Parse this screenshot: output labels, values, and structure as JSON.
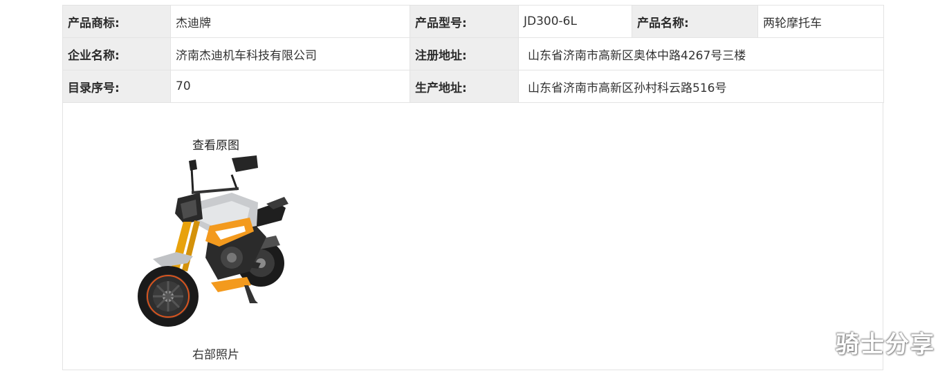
{
  "info": {
    "row1": {
      "brand_label": "产品商标:",
      "brand_value": "杰迪牌",
      "model_label": "产品型号:",
      "model_value": "JD300-6L",
      "name_label": "产品名称:",
      "name_value": "两轮摩托车"
    },
    "row2": {
      "company_label": "企业名称:",
      "company_value": "济南杰迪机车科技有限公司",
      "reg_addr_label": "注册地址:",
      "reg_addr_value": "山东省济南市高新区奥体中路4267号三楼"
    },
    "row3": {
      "catalog_label": "目录序号:",
      "catalog_value": "70",
      "prod_addr_label": "生产地址:",
      "prod_addr_value": "山东省济南市高新区孙村科云路516号"
    }
  },
  "photo": {
    "view_original": "查看原图",
    "caption": "右部照片",
    "image_icon": "motorcycle-illustration"
  },
  "watermark": "骑士分享",
  "colors": {
    "label_bg": "#eeeeee",
    "border": "#e3e3e3",
    "accent_orange": "#f39a1e",
    "body_silver": "#c9cbce"
  }
}
